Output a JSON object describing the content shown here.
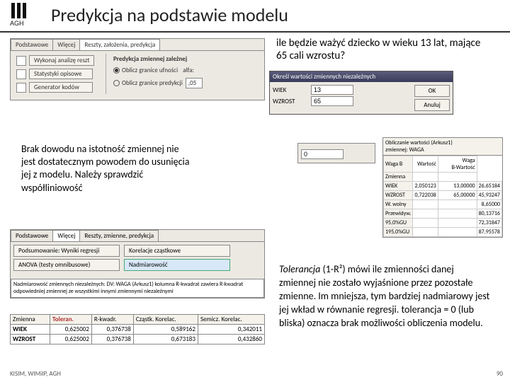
{
  "header": {
    "logo_text": "AGH",
    "title": "Predykcja na podstawie modelu"
  },
  "top_panel": {
    "tabs": [
      "Podstawowe",
      "Więcej",
      "Reszty, założenia, predykcja"
    ],
    "buttons": {
      "wykonaj": "Wykonaj analizę reszt",
      "stat_opisowe": "Statystyki opisowe",
      "generator": "Generator kodów"
    },
    "pred_label": "Predykcja zmiennej zależnej",
    "radio1": "Oblicz granice ufności",
    "radio2": "Oblicz granice predykcji",
    "alfa_label": "alfa:",
    "alfa_value": ",05"
  },
  "question": "ile będzie ważyć dziecko w wieku 13 lat, mające 65 cali wzrostu?",
  "dialog": {
    "title": "Określ wartości zmiennych niezależnych",
    "vars": [
      {
        "name": "WIEK",
        "value": "13"
      },
      {
        "name": "WZROST",
        "value": "65"
      }
    ],
    "ok": "OK",
    "cancel": "Anuluj"
  },
  "small_panel": {
    "value": "0"
  },
  "results": {
    "header1": "Obliczanie wartości (Arkusz1)",
    "header2": "zmiennej: WAGA",
    "cols": [
      "",
      "Waga B",
      "Wartość",
      "Waga B·Wartość"
    ],
    "rows": [
      [
        "Zmienna",
        "",
        "",
        ""
      ],
      [
        "WIEK",
        "2,050123",
        "13,00000",
        "26,65184"
      ],
      [
        "WZROST",
        "0,722038",
        "65,00000",
        "45,93247"
      ],
      [
        "W. wolny",
        "",
        "",
        "8,65000"
      ],
      [
        "Przewidyw.",
        "",
        "",
        "80,13716"
      ],
      [
        "95,0%GU",
        "",
        "",
        "72,31847"
      ],
      [
        "195,0%GU",
        "",
        "",
        "87,95578"
      ]
    ]
  },
  "note_left": "Brak dowodu na istotność zmiennej nie jest dostatecznym powodem do usunięcia jej z modelu. Należy sprawdzić współliniowość",
  "lower_panel": {
    "tabs": [
      "Podstawowe",
      "Więcej",
      "Reszty, zmienne, predykcja"
    ],
    "left_btns": [
      "Podsumowanie: Wyniki regresji",
      "ANOVA (testy omnibusowe)"
    ],
    "right_btns": [
      "Korelacje cząstkowe",
      "Nadmiarowość"
    ],
    "desc": "Nadmiarowość zmiennych niezależnych: DV: WAGA (Arkusz1) kolumna R-kwadrat zawiera R-kwadrat odpowiedniej zmiennej ze wszystkimi innymi zmiennymi niezależnymi"
  },
  "tol_table": {
    "headers": [
      "Zmienna",
      "Toleran.",
      "R-kwadr.",
      "Cząstk. Korelac.",
      "Semicz. Korelac."
    ],
    "rows": [
      [
        "WIEK",
        "0,625002",
        "0,376738",
        "0,589162",
        "0,342011"
      ],
      [
        "WZROST",
        "0,625002",
        "0,376738",
        "0,673183",
        "0,432860"
      ]
    ]
  },
  "tolerancja": {
    "lead": "Tolerancja",
    "text": " (1-R²) mówi ile zmienności danej zmiennej nie zostało wyjaśnione przez pozostałe zmienne. Im mniejsza, tym bardziej nadmiarowy jest jej wkład w równanie regresji. tolerancja = 0 (lub bliska) oznacza brak możliwości obliczenia modelu."
  },
  "footer": "KISIM, WIMiIP, AGH",
  "page": "90"
}
